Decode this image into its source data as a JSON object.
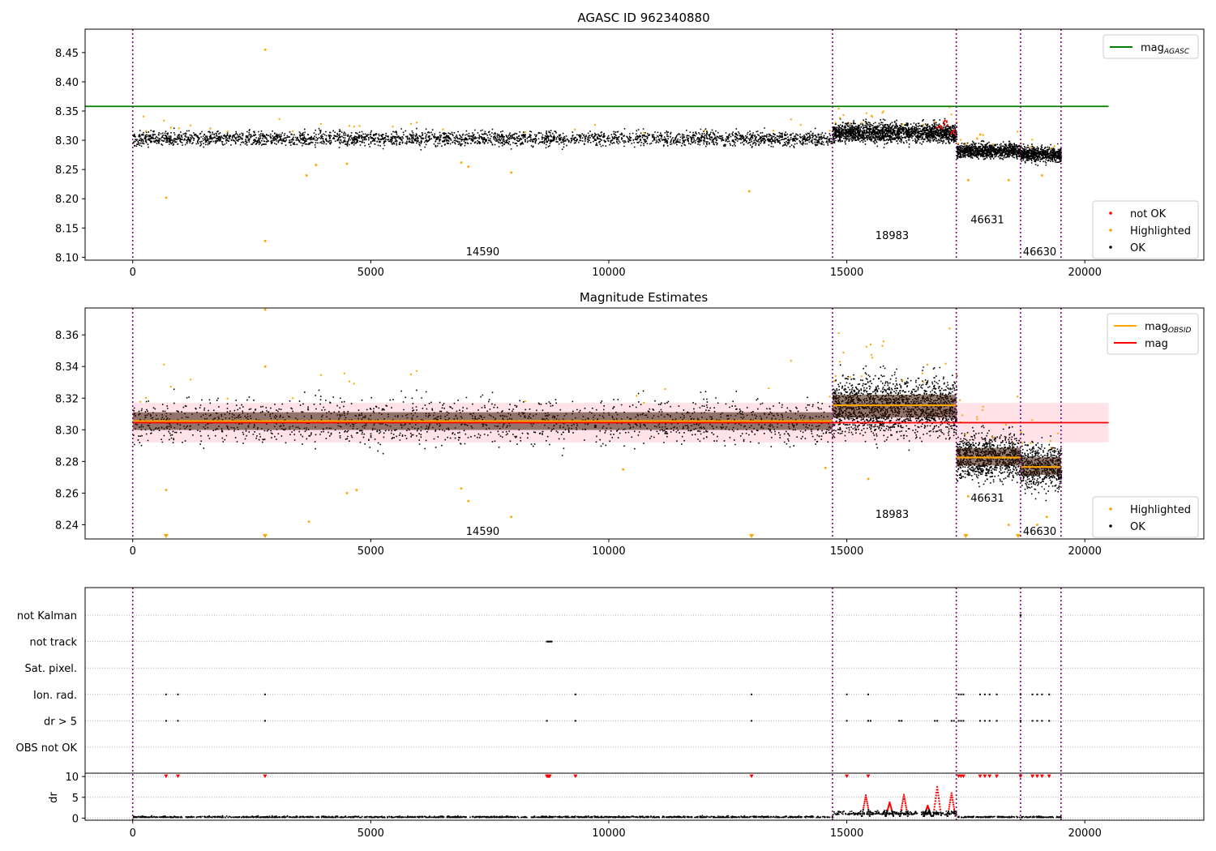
{
  "panels": {
    "top": {
      "title": "AGASC ID 962340880"
    },
    "middle": {
      "title": "Magnitude Estimates"
    },
    "bottom": {
      "title": ""
    }
  },
  "colors": {
    "ok": "#000000",
    "highlighted": "#ffa500",
    "not_ok": "#ff0000",
    "mag_agasc": "#008000",
    "mag_obsid": "#ffa500",
    "mag": "#ff0000",
    "obs_boundary": "#800080",
    "band": "#ffc0cb",
    "gridline": "#b0b0b0"
  },
  "chart_data": [
    {
      "type": "scatter",
      "title": "AGASC ID 962340880",
      "xlim": [
        -1000,
        22500
      ],
      "ylim": [
        8.095,
        8.49
      ],
      "xticks": [
        0,
        5000,
        10000,
        15000,
        20000
      ],
      "yticks": [
        8.1,
        8.15,
        8.2,
        8.25,
        8.3,
        8.35,
        8.4,
        8.45
      ],
      "hlines": [
        {
          "name": "mag_AGASC",
          "y": 8.358,
          "x_range": [
            -1000,
            20500
          ]
        }
      ],
      "obs_boundaries": [
        0,
        14700,
        17300,
        18650,
        19500
      ],
      "segments": [
        {
          "obsid": "14590",
          "x_range": [
            0,
            14700
          ],
          "center": 8.304,
          "spread": 0.006
        },
        {
          "obsid": "18983",
          "x_range": [
            14700,
            17300
          ],
          "center": 8.314,
          "spread": 0.008
        },
        {
          "obsid": "46631",
          "x_range": [
            17300,
            18650
          ],
          "center": 8.283,
          "spread": 0.006
        },
        {
          "obsid": "46630",
          "x_range": [
            18650,
            19500
          ],
          "center": 8.277,
          "spread": 0.006
        }
      ],
      "obsid_labels": [
        {
          "text": "14590",
          "x": 7000,
          "y": 8.11
        },
        {
          "text": "18983",
          "x": 15600,
          "y": 8.138
        },
        {
          "text": "46631",
          "x": 17600,
          "y": 8.165
        },
        {
          "text": "46630",
          "x": 18700,
          "y": 8.11
        }
      ],
      "highlighted_outliers": [
        [
          700,
          8.202
        ],
        [
          2780,
          8.455
        ],
        [
          2780,
          8.128
        ],
        [
          3650,
          8.24
        ],
        [
          12950,
          8.213
        ],
        [
          7950,
          8.245
        ],
        [
          6900,
          8.262
        ],
        [
          7050,
          8.255
        ],
        [
          4500,
          8.26
        ],
        [
          3850,
          8.258
        ],
        [
          17550,
          8.232
        ],
        [
          18400,
          8.232
        ],
        [
          17800,
          8.31
        ],
        [
          19100,
          8.24
        ]
      ],
      "not_ok_points": [
        [
          16950,
          8.325
        ],
        [
          17100,
          8.33
        ],
        [
          17250,
          8.315
        ]
      ],
      "legend_upper": [
        {
          "label": "mag",
          "sub": "AGASC",
          "color": "#008000",
          "marker": "line"
        }
      ],
      "legend_lower": [
        {
          "label": "not OK",
          "color": "#ff0000",
          "marker": "dot"
        },
        {
          "label": "Highlighted",
          "color": "#ffa500",
          "marker": "dot"
        },
        {
          "label": "OK",
          "color": "#000000",
          "marker": "dot"
        }
      ]
    },
    {
      "type": "scatter",
      "title": "Magnitude Estimates",
      "xlim": [
        -1000,
        22500
      ],
      "ylim": [
        8.231,
        8.377
      ],
      "xticks": [
        0,
        5000,
        10000,
        15000,
        20000
      ],
      "yticks": [
        8.24,
        8.26,
        8.28,
        8.3,
        8.32,
        8.34,
        8.36
      ],
      "hlines": [
        {
          "name": "mag",
          "y": 8.3045,
          "x_range": [
            0,
            20500
          ]
        }
      ],
      "band": {
        "y_range": [
          8.292,
          8.317
        ],
        "x_range": [
          0,
          20500
        ]
      },
      "obsid_means": [
        {
          "x_range": [
            0,
            14700
          ],
          "y": 8.3055
        },
        {
          "x_range": [
            14700,
            17300
          ],
          "y": 8.3155
        },
        {
          "x_range": [
            17300,
            18650
          ],
          "y": 8.2825
        },
        {
          "x_range": [
            18650,
            19500
          ],
          "y": 8.2765
        }
      ],
      "obs_boundaries": [
        0,
        14700,
        17300,
        18650,
        19500
      ],
      "segments": [
        {
          "obsid": "14590",
          "x_range": [
            0,
            14700
          ],
          "center": 8.3055,
          "spread": 0.007
        },
        {
          "obsid": "18983",
          "x_range": [
            14700,
            17300
          ],
          "center": 8.315,
          "spread": 0.009
        },
        {
          "obsid": "46631",
          "x_range": [
            17300,
            18650
          ],
          "center": 8.283,
          "spread": 0.007
        },
        {
          "obsid": "46630",
          "x_range": [
            18650,
            19500
          ],
          "center": 8.277,
          "spread": 0.007
        }
      ],
      "obsid_labels": [
        {
          "text": "14590",
          "x": 7000,
          "y": 8.236
        },
        {
          "text": "18983",
          "x": 15600,
          "y": 8.247
        },
        {
          "text": "46631",
          "x": 17600,
          "y": 8.257
        },
        {
          "text": "46630",
          "x": 18700,
          "y": 8.236
        }
      ],
      "highlighted_outliers": [
        [
          2780,
          8.376
        ],
        [
          2780,
          8.34
        ],
        [
          700,
          8.262
        ],
        [
          4500,
          8.26
        ],
        [
          4700,
          8.262
        ],
        [
          3700,
          8.242
        ],
        [
          7950,
          8.245
        ],
        [
          6900,
          8.263
        ],
        [
          7050,
          8.255
        ],
        [
          10300,
          8.275
        ],
        [
          17550,
          8.258
        ],
        [
          18400,
          8.24
        ],
        [
          19000,
          8.24
        ],
        [
          19200,
          8.245
        ],
        [
          15450,
          8.269
        ],
        [
          14550,
          8.276
        ]
      ],
      "offscale_markers": [
        700,
        2780,
        13000,
        17500,
        18600
      ],
      "legend_upper": [
        {
          "label": "mag",
          "sub": "OBSID",
          "color": "#ffa500",
          "marker": "line"
        },
        {
          "label": "mag",
          "sub": "",
          "color": "#ff0000",
          "marker": "line"
        }
      ],
      "legend_lower": [
        {
          "label": "Highlighted",
          "color": "#ffa500",
          "marker": "dot"
        },
        {
          "label": "OK",
          "color": "#000000",
          "marker": "dot"
        }
      ]
    },
    {
      "type": "scatter",
      "title": "",
      "xlim": [
        -1000,
        22500
      ],
      "flag_rows": [
        "not Kalman",
        "not track",
        "Sat. pixel.",
        "Ion. rad.",
        "dr > 5",
        "OBS not OK"
      ],
      "flags": {
        "not Kalman": [
          18650
        ],
        "not track": [
          8700,
          8720,
          8740,
          8760,
          8780,
          8800
        ],
        "Sat. pixel.": [],
        "Ion. rad.": [
          700,
          950,
          2780,
          9300,
          13000,
          15000,
          15450,
          17350,
          17400,
          17450,
          17800,
          17900,
          18000,
          18150,
          18650,
          18900,
          19000,
          19100,
          19250
        ],
        "dr > 5": [
          700,
          950,
          2780,
          8700,
          9300,
          13000,
          15000,
          15450,
          15500,
          16100,
          16150,
          16850,
          16900,
          17200,
          17250,
          17350,
          17400,
          17450,
          17800,
          17900,
          18000,
          18150,
          18650,
          18900,
          19000,
          19100,
          19250
        ],
        "OBS not OK": []
      },
      "dr_ylim": [
        -0.5,
        10.8
      ],
      "dr_yticks": [
        0,
        5,
        10
      ],
      "dr_ylabel": "dr",
      "dr_clipped_points": [
        700,
        950,
        2780,
        8700,
        8720,
        8740,
        8760,
        9300,
        13000,
        15000,
        15450,
        17350,
        17400,
        17450,
        17800,
        17900,
        18000,
        18150,
        18650,
        18900,
        19000,
        19100,
        19250
      ],
      "dr_spikes": [
        [
          15400,
          5.5
        ],
        [
          15900,
          3.8
        ],
        [
          16200,
          5.6
        ],
        [
          16700,
          3.0
        ],
        [
          16900,
          7.5
        ],
        [
          17200,
          6.0
        ]
      ],
      "obs_boundaries": [
        0,
        14700,
        17300,
        18650,
        19500
      ],
      "xticks": [
        0,
        5000,
        10000,
        15000,
        20000
      ]
    }
  ]
}
